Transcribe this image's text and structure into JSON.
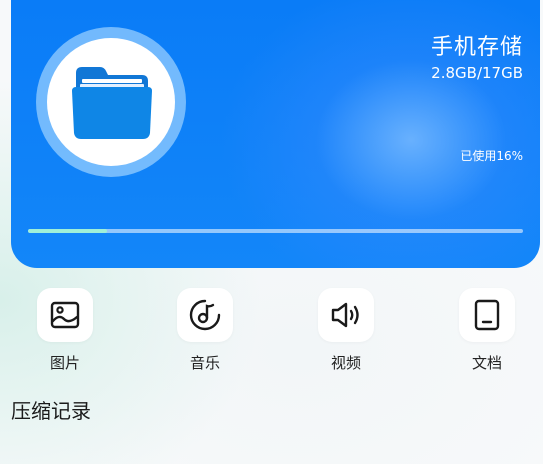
{
  "storage": {
    "title": "手机存储",
    "size": "2.8GB/17GB",
    "used_label": "已使用16%",
    "used_fraction": 0.16,
    "accent": "#0a7cf7",
    "progress_color": "#9ff0d8"
  },
  "categories": [
    {
      "label": "图片",
      "icon": "image-icon"
    },
    {
      "label": "音乐",
      "icon": "music-icon"
    },
    {
      "label": "视频",
      "icon": "video-speaker-icon"
    },
    {
      "label": "文档",
      "icon": "document-icon"
    }
  ],
  "section": {
    "title": "压缩记录"
  }
}
